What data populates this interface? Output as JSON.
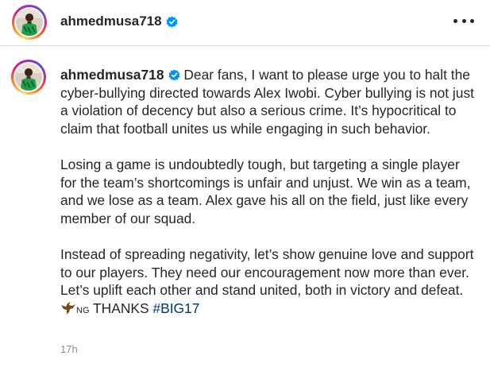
{
  "header": {
    "username": "ahmedmusa718",
    "verified_icon": "verified-badge-icon",
    "more_icon": "more-options-icon"
  },
  "post": {
    "username": "ahmedmusa718",
    "paragraphs": [
      "Dear fans, I want to please urge you to halt the cyber-bullying directed towards Alex Iwobi. Cyber bullying is not just a violation of decency but also a serious crime. It’s hypocritical to claim that football unites us while engaging in such behavior.",
      "Losing a game is undoubtedly tough, but targeting a single player for the team’s shortcomings is unfair and unjust. We win as a team, and we lose as a team. Alex gave his all on the field, just like every member of our squad.",
      "Instead of spreading negativity, let’s show genuine love and support to our players. They need our encouragement now more than ever. Let’s uplift each other and stand united, both in victory and defeat."
    ],
    "emoji_icon": "eagle-emoji-icon",
    "emoji_suffix": "NG",
    "closing_text": "THANKS",
    "hashtag": "#BIG17",
    "timestamp": "17h"
  },
  "colors": {
    "verified_blue": "#0095f6",
    "hashtag_blue": "#00376b",
    "text": "#262626",
    "muted": "#8e8e8e",
    "jersey_green": "#1e9e4a"
  }
}
